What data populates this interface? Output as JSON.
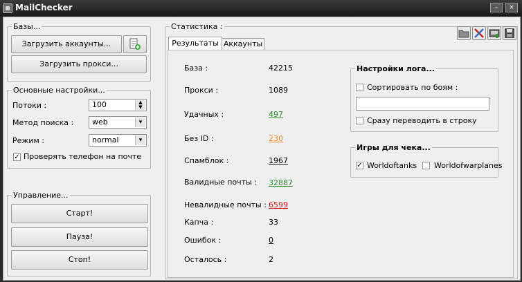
{
  "window": {
    "title": "MailChecker"
  },
  "bases": {
    "title": "Базы...",
    "load_accounts": "Загрузить аккаунты...",
    "load_proxy": "Загрузить прокси..."
  },
  "settings": {
    "title": "Основные настройки...",
    "threads_label": "Потоки :",
    "threads_value": "100",
    "search_label": "Метод поиска :",
    "search_value": "web",
    "mode_label": "Режим  :",
    "mode_value": "normal",
    "check_phone_label": "Проверять телефон на почте",
    "check_phone_checked": true
  },
  "control": {
    "title": "Управление...",
    "start": "Старт!",
    "pause": "Пауза!",
    "stop": "Стоп!"
  },
  "statistics": {
    "title": "Статистика :",
    "tabs": [
      "Результаты",
      "Аккаунты"
    ],
    "rows": [
      {
        "label": "База :",
        "value": "42215"
      },
      {
        "label": "Прокси :",
        "value": "1089"
      },
      {
        "label": "Удачных :",
        "value": "497"
      },
      {
        "label": "Без ID :",
        "value": "230"
      },
      {
        "label": "Спамблок :",
        "value": "1967"
      },
      {
        "label": "Валидные почты :",
        "value": "32887"
      },
      {
        "label": "Невалидные почты :",
        "value": "6599"
      },
      {
        "label": "Капча :",
        "value": "33"
      },
      {
        "label": "Ошибок :",
        "value": "0"
      },
      {
        "label": "Осталось :",
        "value": "2"
      }
    ]
  },
  "log_settings": {
    "title": "Настройки лога...",
    "sort_label": "Сортировать по боям :",
    "sort_checked": false,
    "input_value": "",
    "convert_label": "Сразу переводить в строку",
    "convert_checked": false
  },
  "games": {
    "title": "Игры для чека...",
    "items": [
      {
        "label": "Worldoftanks",
        "checked": true
      },
      {
        "label": "Worldofwarplanes",
        "checked": false
      }
    ]
  },
  "colors": {
    "success": "#2e8b2e",
    "no_id": "#f08c2c",
    "invalid": "#d11a1a"
  },
  "toolbar_icons": [
    "folder-icon",
    "tools-icon",
    "export-icon",
    "save-icon"
  ]
}
